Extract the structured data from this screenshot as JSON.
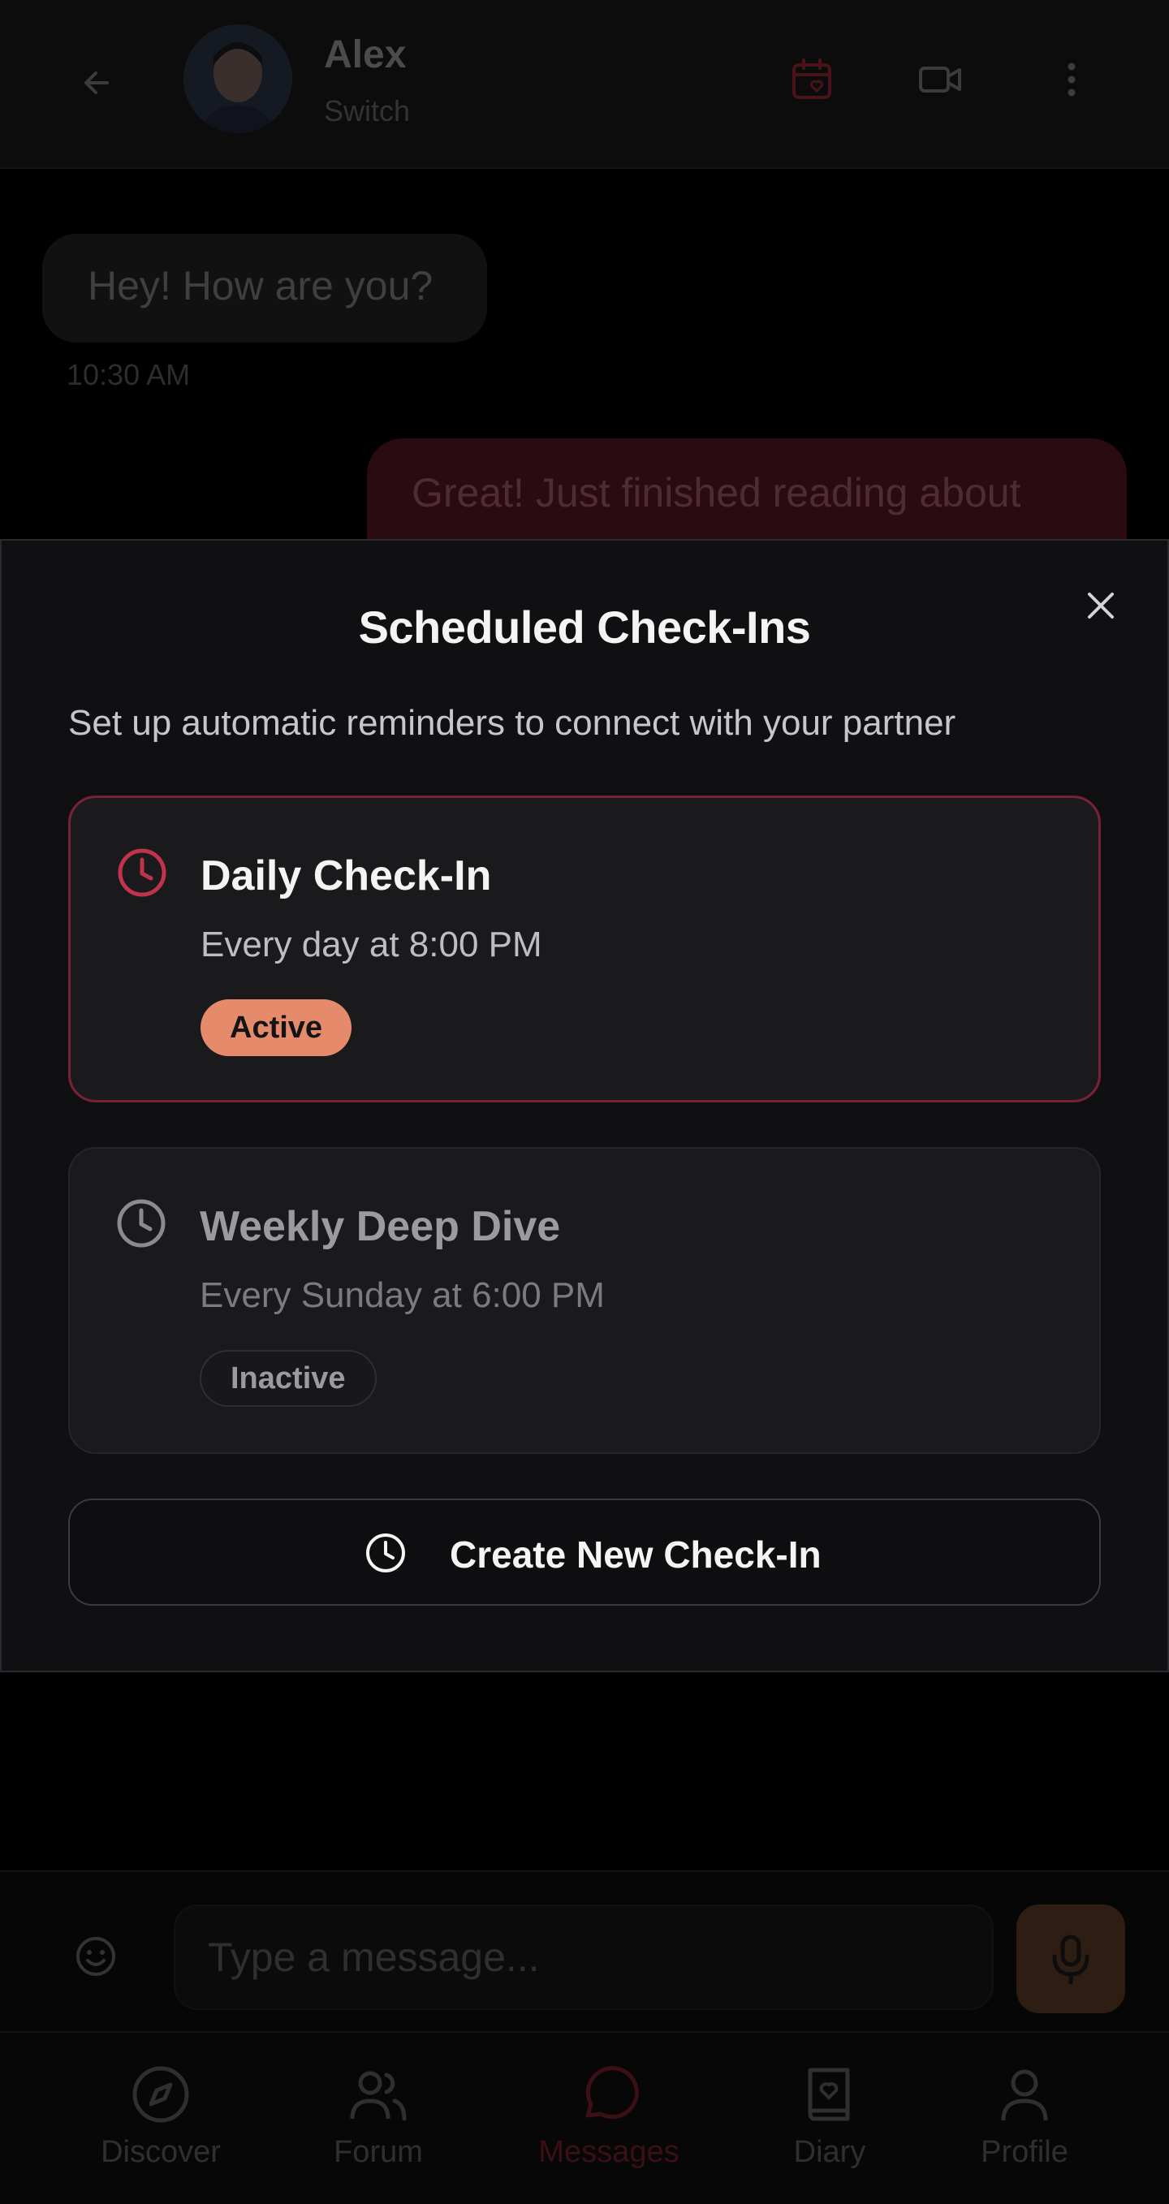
{
  "header": {
    "contact_name": "Alex",
    "contact_status": "Switch"
  },
  "messages": [
    {
      "text": "Hey! How are you?",
      "time": "10:30 AM",
      "direction": "incoming"
    },
    {
      "text": "Great! Just finished reading about",
      "direction": "outgoing"
    }
  ],
  "composer": {
    "placeholder": "Type a message..."
  },
  "nav": {
    "items": [
      {
        "label": "Discover",
        "icon": "compass-icon"
      },
      {
        "label": "Forum",
        "icon": "users-icon"
      },
      {
        "label": "Messages",
        "icon": "chat-bubble-icon",
        "active": true
      },
      {
        "label": "Diary",
        "icon": "book-heart-icon"
      },
      {
        "label": "Profile",
        "icon": "person-icon"
      }
    ]
  },
  "modal": {
    "title": "Scheduled Check-Ins",
    "subtitle": "Set up automatic reminders to connect with your partner",
    "checkins": [
      {
        "title": "Daily Check-In",
        "schedule": "Every day at 8:00 PM",
        "status": "Active"
      },
      {
        "title": "Weekly Deep Dive",
        "schedule": "Every Sunday at 6:00 PM",
        "status": "Inactive"
      }
    ],
    "create_label": "Create New Check-In"
  },
  "colors": {
    "accent": "#c0334d",
    "active_badge": "#e58a6b",
    "modal_bg": "#101012",
    "card_bg": "#1a1a1d"
  }
}
